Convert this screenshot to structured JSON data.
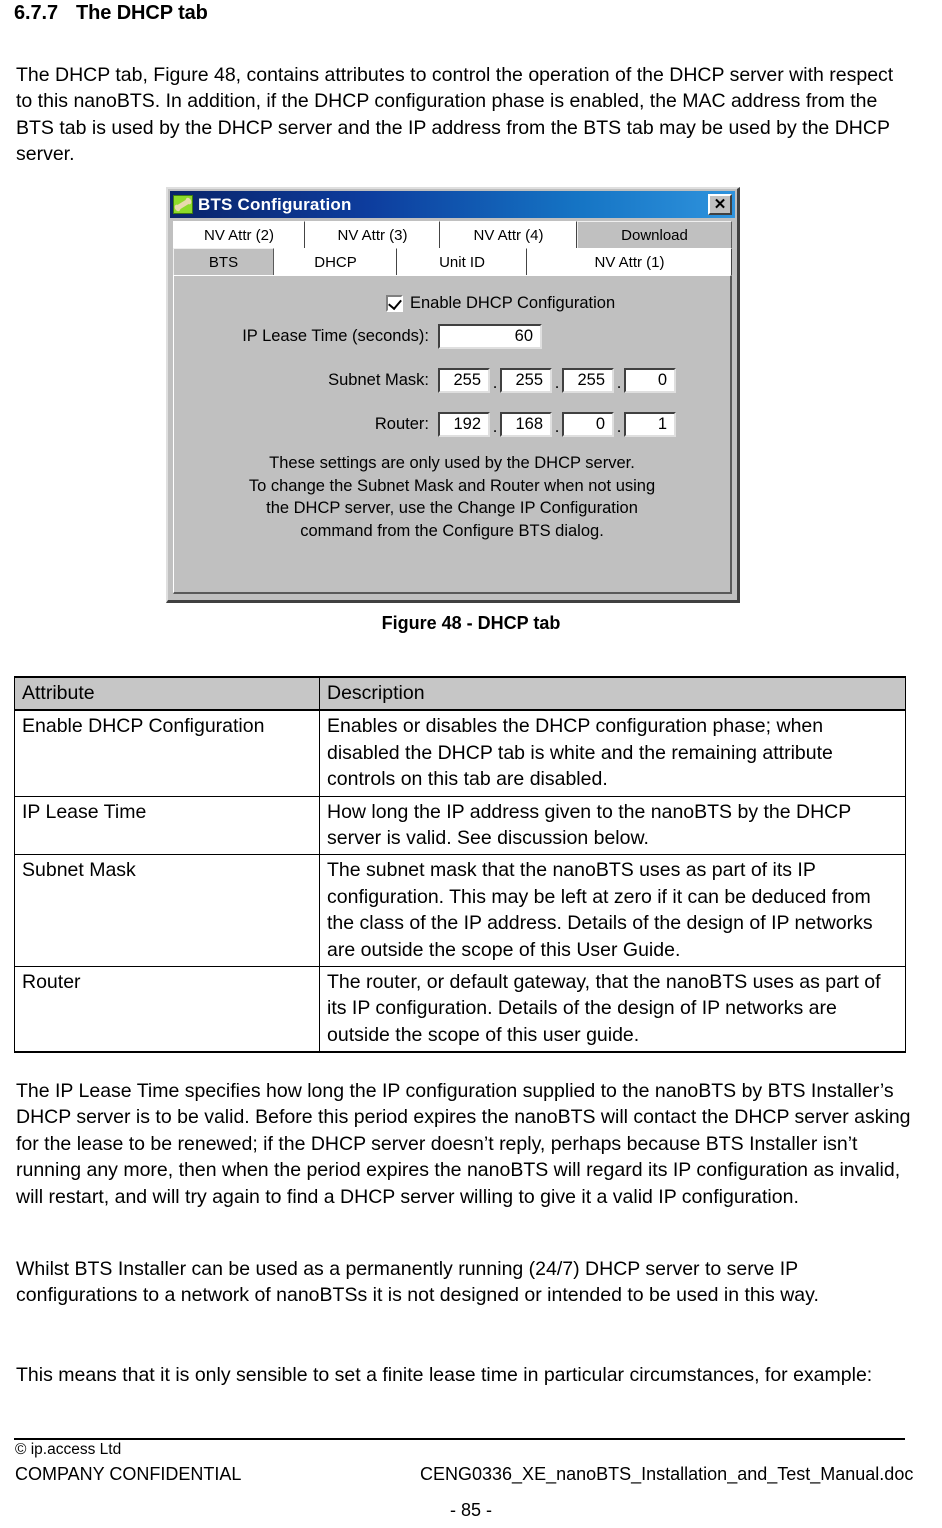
{
  "heading": {
    "number": "6.7.7",
    "title": "The DHCP tab"
  },
  "intro_paragraph": "The DHCP tab, Figure 48, contains attributes to control the operation of the DHCP server with respect to this nanoBTS. In addition, if the DHCP configuration phase is enabled, the MAC address from the BTS tab is used by the DHCP server and the IP address from the BTS tab may be used by the DHCP server.",
  "figure": {
    "caption": "Figure 48 - DHCP tab",
    "dialog": {
      "title": "BTS Configuration",
      "icon": "bone-icon",
      "close_label": "✕",
      "tabs_row_top": [
        {
          "label": "NV Attr (2)",
          "state": "white"
        },
        {
          "label": "NV Attr (3)",
          "state": "white"
        },
        {
          "label": "NV Attr (4)",
          "state": "white"
        },
        {
          "label": "Download",
          "state": "inactive"
        }
      ],
      "tabs_row_bottom": [
        {
          "label": "BTS",
          "state": "inactive"
        },
        {
          "label": "DHCP",
          "state": "active"
        },
        {
          "label": "Unit ID",
          "state": "white"
        },
        {
          "label": "NV Attr (1)",
          "state": "white"
        }
      ],
      "enable_checkbox": {
        "label": "Enable DHCP Configuration",
        "checked": true
      },
      "lease": {
        "label": "IP Lease Time (seconds):",
        "value": "60"
      },
      "subnet": {
        "label": "Subnet Mask:",
        "octets": [
          "255",
          "255",
          "255",
          "0"
        ],
        "separator": "."
      },
      "router": {
        "label": "Router:",
        "octets": [
          "192",
          "168",
          "0",
          "1"
        ],
        "separator": "."
      },
      "help_lines": [
        "These settings are only used by the DHCP server.",
        "To change the Subnet Mask and Router when not using",
        "the DHCP server, use the Change IP Configuration",
        "command from the Configure BTS dialog."
      ]
    }
  },
  "table": {
    "headers": [
      "Attribute",
      "Description"
    ],
    "rows": [
      {
        "attribute": "Enable DHCP Configuration",
        "description": "Enables or disables the DHCP configuration phase; when disabled the DHCP tab is white and the remaining attribute controls on this tab are disabled."
      },
      {
        "attribute": "IP Lease Time",
        "description": "How long the IP address given to the nanoBTS by the DHCP server is valid. See discussion below."
      },
      {
        "attribute": "Subnet Mask",
        "description": "The subnet mask that the nanoBTS uses as part of its IP configuration. This may be left at zero if it can be deduced from the class of the IP address. Details of the design of IP networks are outside the scope of this User Guide."
      },
      {
        "attribute": "Router",
        "description": "The router, or default gateway, that the nanoBTS uses as part of its IP configuration. Details of the design of IP networks are outside the scope of this user guide."
      }
    ]
  },
  "body": {
    "para_lease": "The IP Lease Time specifies how long the IP configuration supplied to the nanoBTS by BTS Installer’s DHCP server is to be valid. Before this period expires the nanoBTS will contact the DHCP server asking for the lease to be renewed; if the DHCP server doesn’t reply, perhaps because BTS Installer isn’t running any more, then when the period expires the nanoBTS will regard its IP configuration as invalid, will restart, and will try again to find a DHCP server willing to give it a valid IP configuration.",
    "para_whilst": "Whilst BTS Installer can be used as a permanently running (24/7) DHCP server to serve IP configurations to a network of nanoBTSs it is not designed or intended to be used in this way.",
    "para_means": "This means that it is only sensible to set a finite lease time in particular circumstances, for example:"
  },
  "footer": {
    "copyright": "© ip.access Ltd",
    "confidential": "COMPANY CONFIDENTIAL",
    "filename": "CENG0336_XE_nanoBTS_Installation_and_Test_Manual.doc",
    "page_number": "- 85 -"
  }
}
